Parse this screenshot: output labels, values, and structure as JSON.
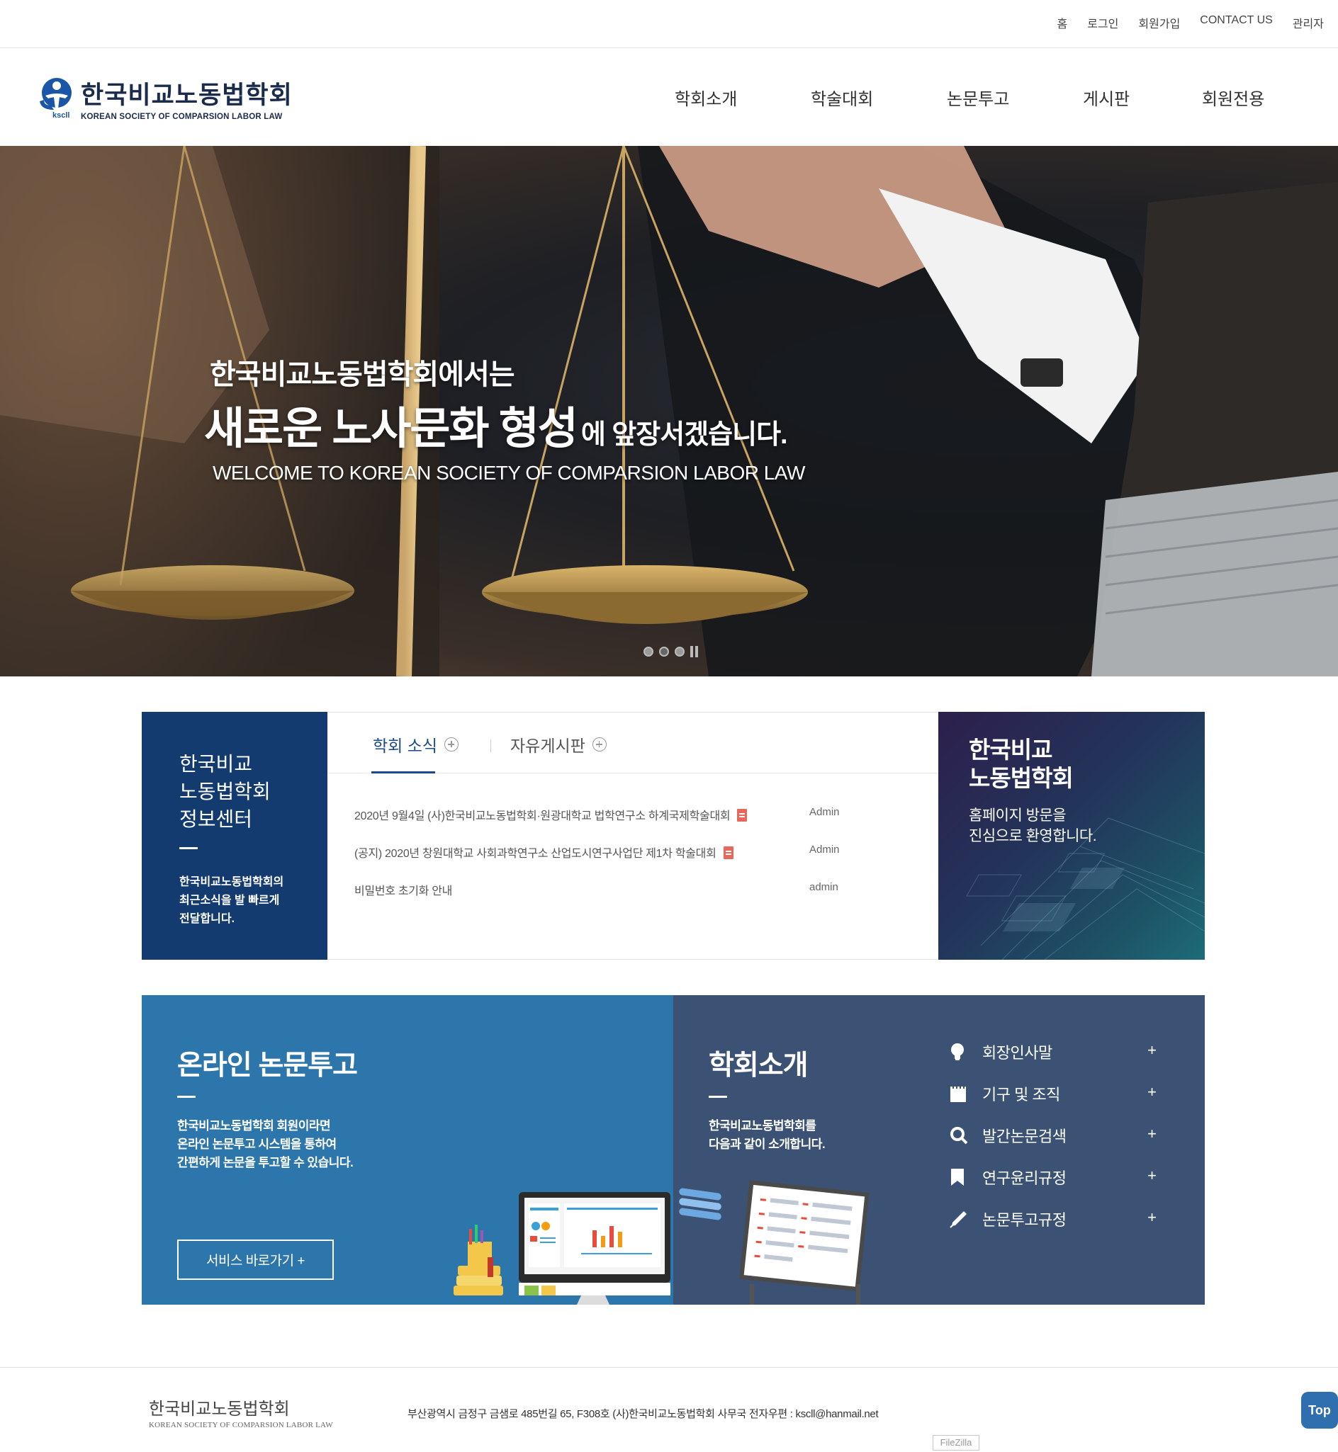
{
  "topbar": {
    "links": [
      "홈",
      "로그인",
      "회원가입",
      "CONTACT US",
      "관리자"
    ]
  },
  "header": {
    "logo_title": "한국비교노동법학회",
    "logo_sub": "KOREAN SOCIETY OF COMPARSION LABOR LAW",
    "logo_mark_text": "kscll",
    "nav": [
      "학회소개",
      "학술대회",
      "논문투고",
      "게시판",
      "회원전용"
    ]
  },
  "hero": {
    "line1": "한국비교노동법학회에서는",
    "line2_big": "새로운 노사문화 형성",
    "line2_small": "에 앞장서겠습니다.",
    "line3": "WELCOME TO KOREAN SOCIETY OF COMPARSION LABOR LAW",
    "slides": 3,
    "active_slide": 2
  },
  "info_center": {
    "title_lines": [
      "한국비교",
      "노동법학회",
      "정보센터"
    ],
    "desc_lines": [
      "한국비교노동법학회의",
      "최근소식을 발 빠르게",
      "전달합니다."
    ]
  },
  "board": {
    "tabs": [
      "학회 소식",
      "자유게시판"
    ],
    "active_tab": 0,
    "posts": [
      {
        "title": "2020년 9월4일 (사)한국비교노동법학회·원광대학교 법학연구소 하계국제학술대회",
        "author": "Admin",
        "attachment": true
      },
      {
        "title": "(공지) 2020년 창원대학교 사회과학연구소 산업도시연구사업단 제1차 학술대회",
        "author": "Admin",
        "attachment": true
      },
      {
        "title": "비밀번호 초기화 안내",
        "author": "admin",
        "attachment": false
      }
    ]
  },
  "welcome_box": {
    "title_lines": [
      "한국비교",
      "노동법학회"
    ],
    "desc_lines": [
      "홈페이지 방문을",
      "진심으로 환영합니다."
    ]
  },
  "online_submit": {
    "title": "온라인 논문투고",
    "desc_lines": [
      "한국비교노동법학회 회원이라면",
      "온라인 논문투고 시스템을 통하여",
      "간편하게 논문을 투고할 수 있습니다."
    ],
    "button": "서비스 바로가기 +"
  },
  "about": {
    "title": "학회소개",
    "desc_lines": [
      "한국비교노동법학회를",
      "다음과 같이 소개합니다."
    ],
    "menu": [
      {
        "label": "회장인사말",
        "icon": "lightbulb-icon"
      },
      {
        "label": "기구 및 조직",
        "icon": "notepad-icon"
      },
      {
        "label": "발간논문검색",
        "icon": "search-icon"
      },
      {
        "label": "연구윤리규정",
        "icon": "bookmark-icon"
      },
      {
        "label": "논문투고규정",
        "icon": "pen-icon"
      }
    ],
    "plus": "+"
  },
  "footer": {
    "logo_title": "한국비교노동법학회",
    "logo_sub": "KOREAN SOCIETY OF COMPARSION LABOR LAW",
    "address": "부산광역시 금정구 금샘로 485번길 65, F308호 (사)한국비교노동법학회 사무국 전자우편 : kscll@hanmail.net"
  },
  "top_button": "Top",
  "overlay_label": "FileZilla",
  "colors": {
    "navy": "#133b70",
    "blue_panel": "#2c76ab",
    "slate_panel": "#3b5274",
    "accent_tab": "#1b4a8a",
    "top_button": "#2f6fb0"
  }
}
